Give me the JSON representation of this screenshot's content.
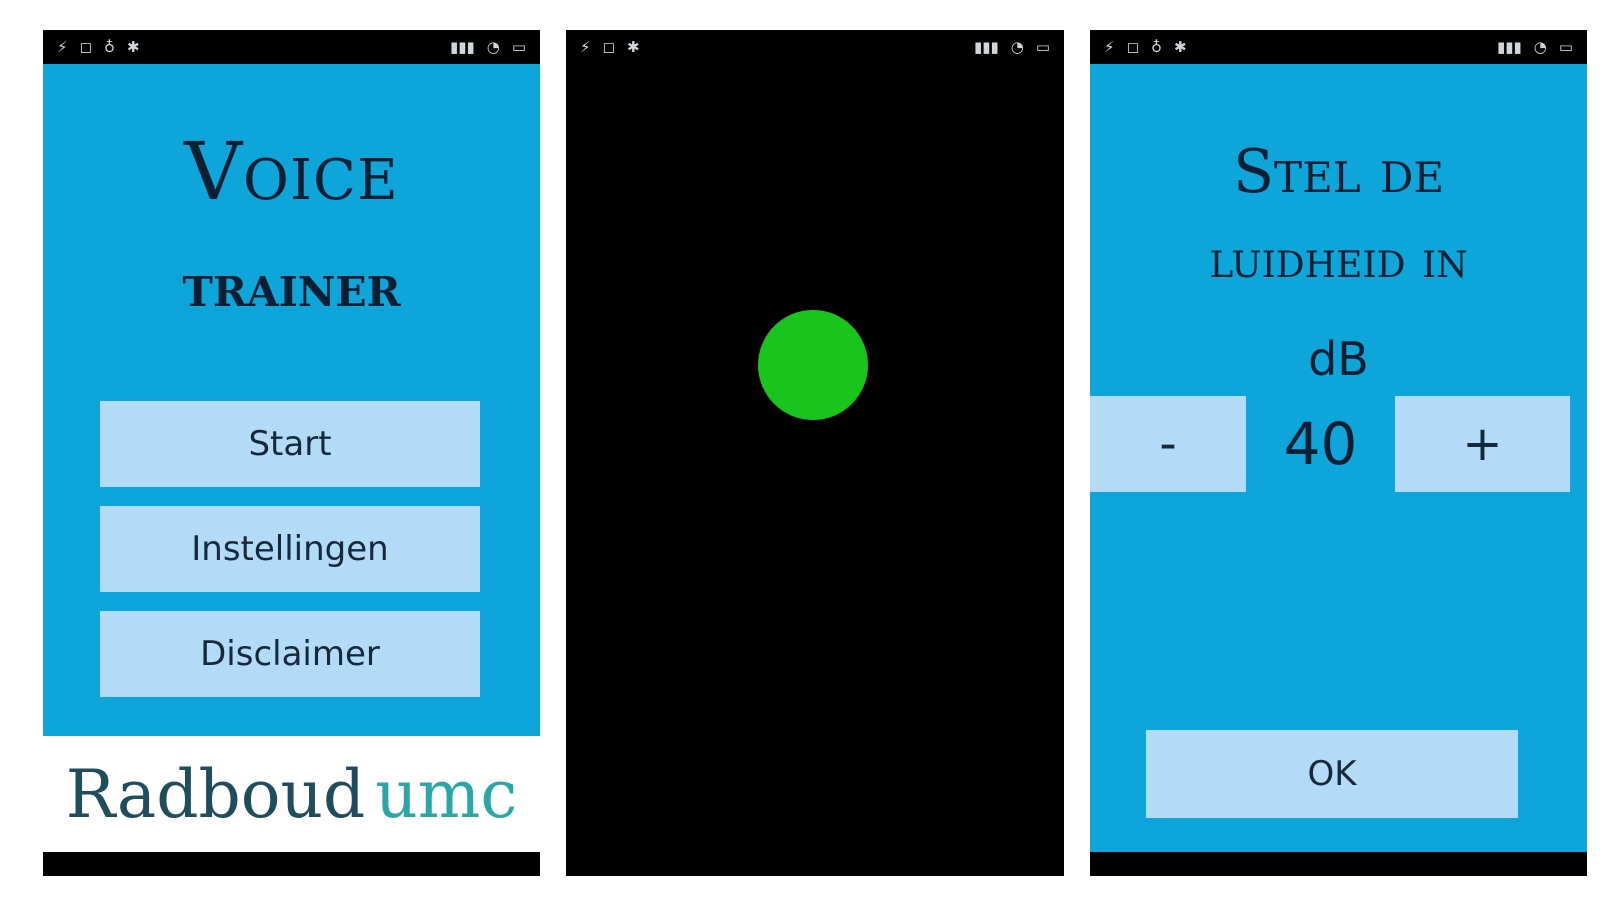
{
  "screen1": {
    "title_line1": "Voice",
    "title_line2": "trainer",
    "buttons": [
      {
        "label": "Start"
      },
      {
        "label": "Instellingen"
      },
      {
        "label": "Disclaimer"
      }
    ],
    "logo": {
      "part1": "Radboud",
      "part2": "umc"
    }
  },
  "screen3": {
    "title_line1": "Stel de",
    "title_line2": "luidheid in",
    "unit": "dB",
    "minus_label": "-",
    "value": "40",
    "plus_label": "+",
    "ok_label": "OK"
  },
  "colors": {
    "app_background": "#0ea5da",
    "button_background": "#b3dbf5",
    "indicator": "#19c41d"
  },
  "icons": [
    "usb-icon",
    "notification-icon",
    "signal-icon",
    "wifi-icon",
    "battery-icon"
  ]
}
